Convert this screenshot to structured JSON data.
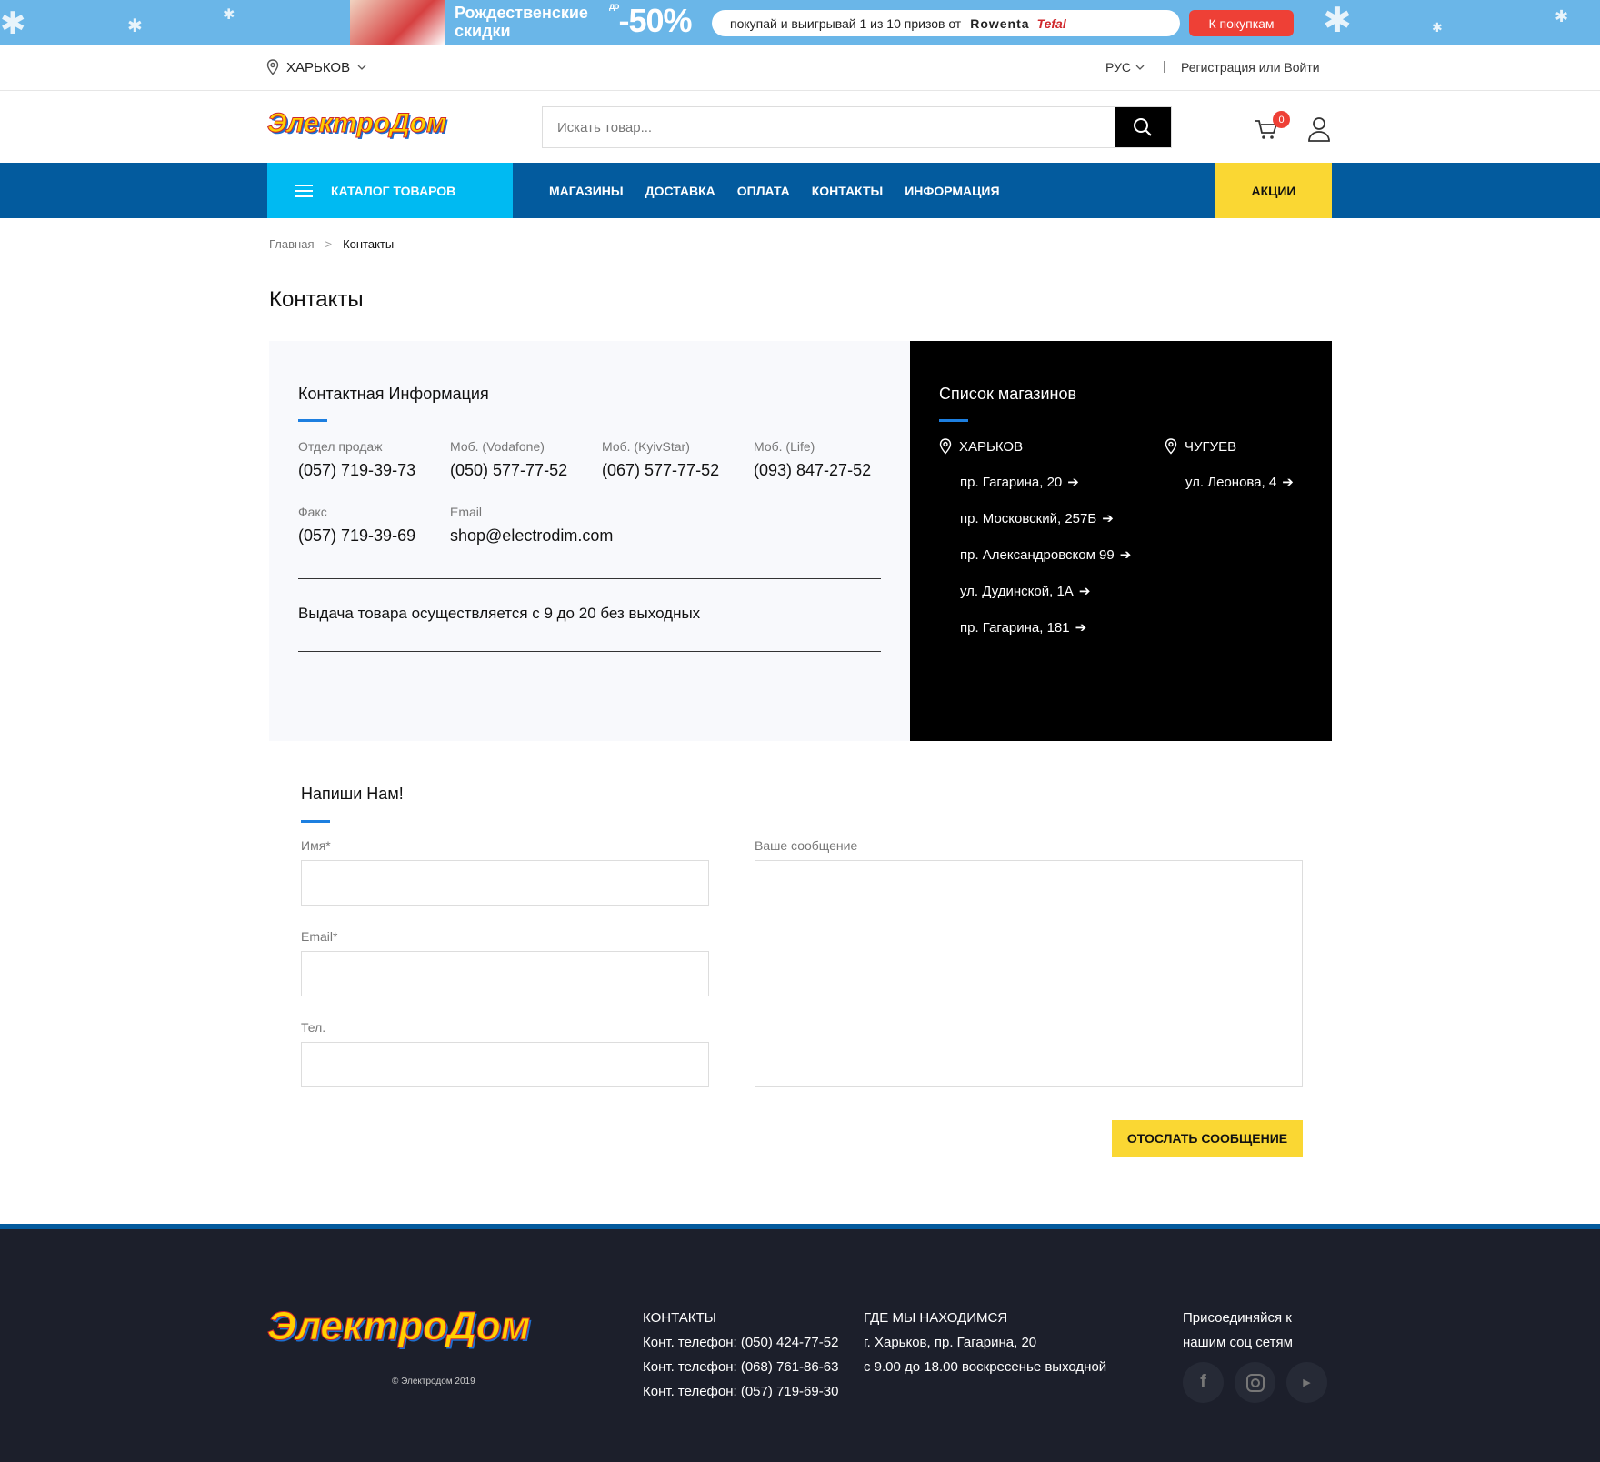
{
  "promo": {
    "title": "Рождественские скидки",
    "discount_prefix": "до",
    "discount": "-50%",
    "text": "покупай и выигрывай 1 из 10 призов от",
    "brand1": "Rowenta",
    "brand2": "Tefal",
    "cta": "К покупкам"
  },
  "topbar": {
    "city": "ХАРЬКОВ",
    "lang": "РУС",
    "separator": "|",
    "login": "Регистрация или Войти"
  },
  "header": {
    "logo": "ЭлектроДом",
    "search_placeholder": "Искать товар...",
    "cart_count": "0"
  },
  "nav": {
    "catalog": "КАТАЛОГ ТОВАРОВ",
    "items": [
      "МАГАЗИНЫ",
      "ДОСТАВКА",
      "ОПЛАТА",
      "КОНТАКТЫ",
      "ИНФОРМАЦИЯ"
    ],
    "sale": "АКЦИИ"
  },
  "breadcrumb": {
    "home": "Главная",
    "arrow": ">",
    "current": "Контакты"
  },
  "page_title": "Контакты",
  "contact_info": {
    "title": "Контактная Информация",
    "entries": [
      {
        "label": "Отдел продаж",
        "value": "(057) 719-39-73"
      },
      {
        "label": "Моб. (Vodafone)",
        "value": "(050) 577-77-52"
      },
      {
        "label": "Моб. (KyivStar)",
        "value": "(067) 577-77-52"
      },
      {
        "label": "Моб. (Life)",
        "value": "(093) 847-27-52"
      },
      {
        "label": "Факс",
        "value": "(057) 719-39-69"
      },
      {
        "label": "Email",
        "value": "shop@electrodim.com"
      }
    ],
    "hours": "Выдача товара осуществляется с 9 до 20 без выходных"
  },
  "stores": {
    "title": "Список магазинов",
    "cities": [
      {
        "name": "ХАРЬКОВ",
        "addresses": [
          "пр. Гагарина, 20",
          "пр. Московский, 257Б",
          "пр. Александровском 99",
          "ул. Дудинской, 1А",
          "пр. Гагарина, 181"
        ]
      },
      {
        "name": "ЧУГУЕВ",
        "addresses": [
          "ул. Леонова, 4"
        ]
      }
    ]
  },
  "form": {
    "title": "Напиши Нам!",
    "name_label": "Имя*",
    "email_label": "Email*",
    "phone_label": "Тел.",
    "message_label": "Ваше сообщение",
    "submit": "ОТОСЛАТЬ СООБЩЕНИЕ"
  },
  "footer": {
    "logo": "ЭлектроДом",
    "copyright": "© Электродом 2019",
    "contacts_title": "КОНТАКТЫ",
    "phones": [
      "Конт. телефон: (050) 424-77-52",
      "Конт. телефон: (068) 761-86-63",
      "Конт. телефон: (057) 719-69-30"
    ],
    "location_title": "ГДЕ МЫ НАХОДИМСЯ",
    "address": "г. Харьков, пр. Гагарина, 20",
    "schedule": "с 9.00 до 18.00 воскресенье выходной",
    "social_line1": "Присоединяйся к",
    "social_line2": "нашим соц сетям",
    "social_icons": [
      "facebook-icon",
      "instagram-icon",
      "youtube-icon"
    ]
  },
  "colors": {
    "nav_blue": "#035b9e",
    "catalog_cyan": "#00baf2",
    "accent_yellow": "#fad733",
    "badge_red": "#ee4036",
    "footer_bg": "#1c1f2b"
  }
}
